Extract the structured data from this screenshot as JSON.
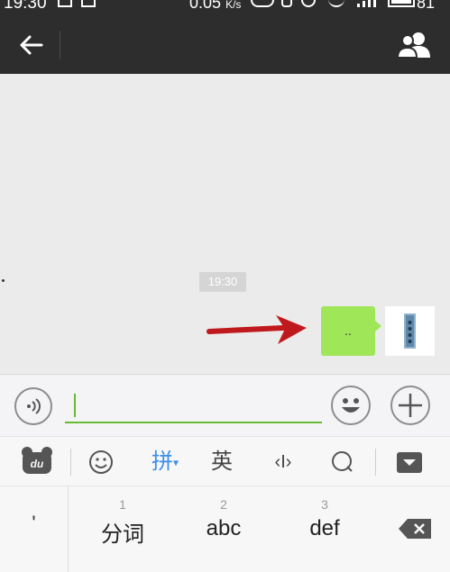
{
  "status_bar": {
    "time": "19:30",
    "network_speed": "0.05",
    "network_speed_unit": "K/s",
    "battery_level": "81"
  },
  "chat": {
    "timestamp": "19:30",
    "messages": [
      {
        "from": "me",
        "text": ".."
      }
    ]
  },
  "keyboard": {
    "toolbar": {
      "pinyin_label": "拼",
      "english_label": "英",
      "cursor_label": "‹I›"
    },
    "apostrophe_label": "'",
    "keys": [
      {
        "number": "1",
        "label": "分词"
      },
      {
        "number": "2",
        "label": "abc"
      },
      {
        "number": "3",
        "label": "def"
      }
    ]
  },
  "colors": {
    "top_bar": "#2d2d2d",
    "chat_background": "#ebebeb",
    "sent_bubble": "#9fe658",
    "input_focus_line": "#66bb33",
    "annotation_arrow": "#c0191d",
    "keyboard_accent": "#3d8ee8"
  },
  "icons": {
    "back": "arrow-left-icon",
    "contacts": "people-icon",
    "voice": "voice-wave-icon",
    "emoji": "smiley-icon",
    "plus": "plus-icon",
    "keyboard_logo": "du-bear-icon",
    "keyboard_emoji": "emoji-outline-icon",
    "search": "search-icon",
    "hide": "chevron-down-icon",
    "delete": "backspace-icon"
  }
}
